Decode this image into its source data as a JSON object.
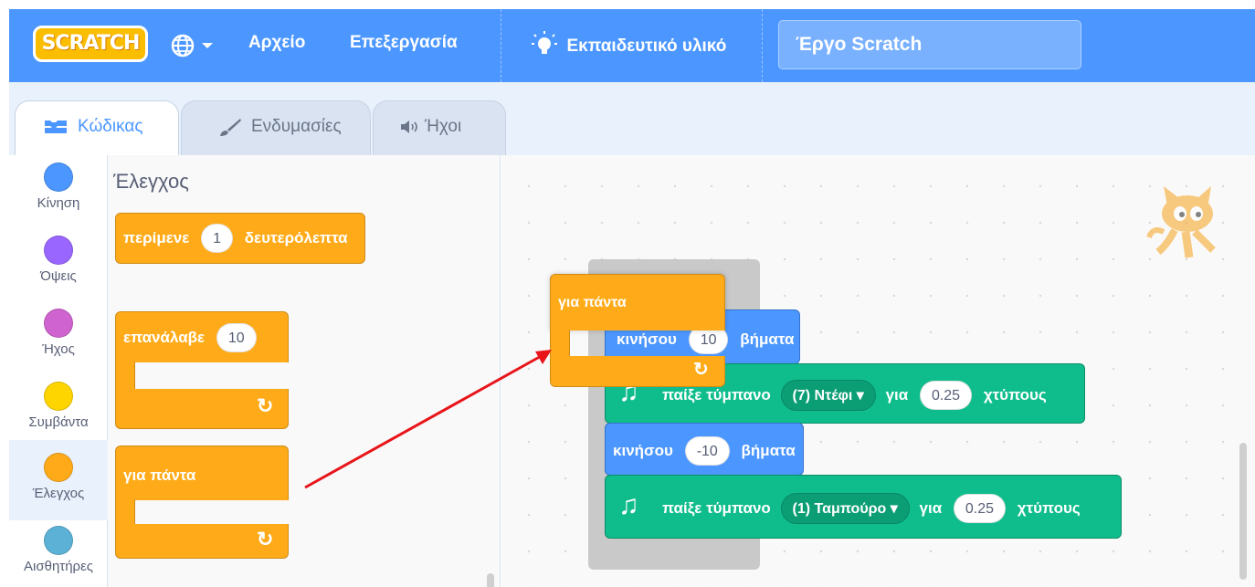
{
  "menubar": {
    "logo": "SCRATCH",
    "file": "Αρχείο",
    "edit": "Επεξεργασία",
    "tutorials": "Εκπαιδευτικό υλικό",
    "project_title": "Έργο Scratch"
  },
  "tabs": {
    "code": "Κώδικας",
    "costumes": "Ενδυμασίες",
    "sounds": "Ήχοι"
  },
  "categories": [
    {
      "label": "Κίνηση",
      "color": "#4c97ff"
    },
    {
      "label": "Όψεις",
      "color": "#9966ff"
    },
    {
      "label": "Ήχος",
      "color": "#cf63cf"
    },
    {
      "label": "Συμβάντα",
      "color": "#ffd500"
    },
    {
      "label": "Έλεγχος",
      "color": "#ffab19"
    },
    {
      "label": "Αισθητήρες",
      "color": "#5cb1d6"
    }
  ],
  "palette": {
    "title": "Έλεγχος",
    "wait": {
      "text1": "περίμενε",
      "value": "1",
      "text2": "δευτερόλεπτα"
    },
    "repeat": {
      "text": "επανάλαβε",
      "value": "10"
    },
    "forever": {
      "text": "για πάντα"
    }
  },
  "workspace": {
    "forever": {
      "text": "για πάντα"
    },
    "move1": {
      "text1": "κινήσου",
      "value": "10",
      "text2": "βήματα"
    },
    "drum1": {
      "text1": "παίξε τύμπανο",
      "drum": "(7) Ντέφι",
      "text2": "για",
      "value": "0.25",
      "text3": "χτύπους"
    },
    "move2": {
      "text1": "κινήσου",
      "value": "-10",
      "text2": "βήματα"
    },
    "drum2": {
      "text1": "παίξε τύμπανο",
      "drum": "(1) Ταμπούρο",
      "text2": "για",
      "value": "0.25",
      "text3": "χτύπους"
    }
  }
}
